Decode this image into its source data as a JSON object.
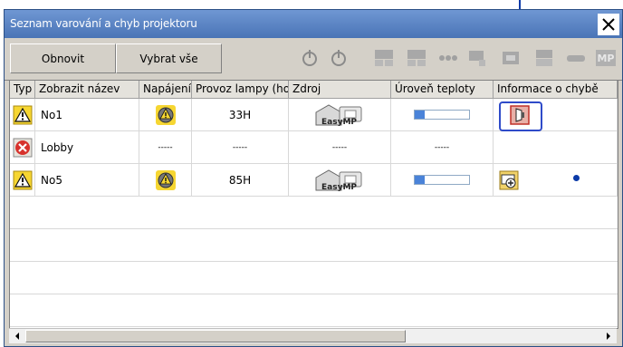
{
  "window": {
    "title": "Seznam varování a chyb projektoru"
  },
  "toolbar": {
    "refresh_label": "Obnovit",
    "select_all_label": "Vybrat vše",
    "mp_label": "MP"
  },
  "columns": [
    "Typ",
    "Zobrazit název",
    "Napájení",
    "Provoz lampy (hod)",
    "Zdroj",
    "Úroveň teploty",
    "Informace o chybě"
  ],
  "rows": [
    {
      "type_icon": "warning-icon",
      "name": "No1",
      "power_icon": "power-warning-icon",
      "lamp": "33H",
      "source_icon": "easymp-icon",
      "source_label": "EasyMP",
      "temperature_level": 0.18,
      "error_icon": "lamp-error-icon"
    },
    {
      "type_icon": "error-icon",
      "name": "Lobby",
      "power": "-----",
      "lamp": "-----",
      "source": "-----",
      "temperature": "-----"
    },
    {
      "type_icon": "warning-icon",
      "name": "No5",
      "power_icon": "power-warning-icon",
      "lamp": "85H",
      "source_icon": "easymp-icon",
      "source_label": "EasyMP",
      "temperature_level": 0.18,
      "error_icon": "network-error-icon"
    }
  ],
  "colors": {
    "title_bar": "#5a82c4",
    "highlight": "#2f4bc9",
    "temperature_fill": "#4a83d9",
    "warning": "#f6d632",
    "error": "#d7322c"
  }
}
